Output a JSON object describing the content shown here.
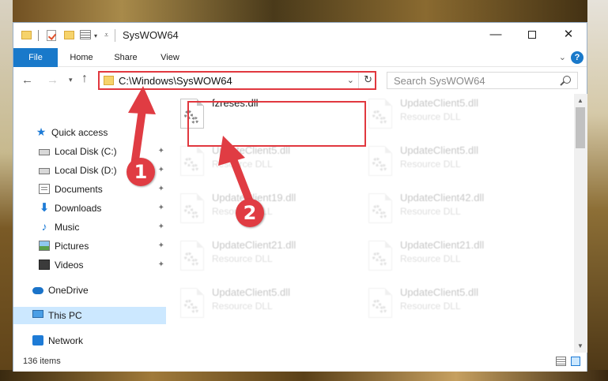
{
  "window": {
    "title": "SysWOW64",
    "minimize": "—",
    "close": "✕"
  },
  "ribbon": {
    "tabs": [
      "File",
      "Home",
      "Share",
      "View"
    ],
    "help": "?",
    "collapse": "⌄"
  },
  "nav": {
    "back": "←",
    "forward": "→",
    "recent": "▾",
    "up": "↑",
    "address": "C:\\Windows\\SysWOW64",
    "address_dropdown": "⌄",
    "refresh": "↻",
    "search_placeholder": "Search SysWOW64"
  },
  "sidebar": {
    "items": [
      {
        "label": "Quick access",
        "icon": "star-icon",
        "pinned": false
      },
      {
        "label": "Local Disk (C:)",
        "icon": "drive-icon",
        "pinned": true
      },
      {
        "label": "Local Disk (D:)",
        "icon": "drive-icon",
        "pinned": true
      },
      {
        "label": "Documents",
        "icon": "documents-icon",
        "pinned": true
      },
      {
        "label": "Downloads",
        "icon": "downloads-icon",
        "pinned": true
      },
      {
        "label": "Music",
        "icon": "music-icon",
        "pinned": true
      },
      {
        "label": "Pictures",
        "icon": "pictures-icon",
        "pinned": true
      },
      {
        "label": "Videos",
        "icon": "videos-icon",
        "pinned": true
      },
      {
        "label": "OneDrive",
        "icon": "onedrive-icon",
        "pinned": false
      },
      {
        "label": "This PC",
        "icon": "pc-icon",
        "pinned": false,
        "selected": true
      },
      {
        "label": "Network",
        "icon": "network-icon",
        "pinned": false
      }
    ],
    "pin_glyph": "📌"
  },
  "files": [
    {
      "name": "fzreses.dll",
      "type": "",
      "highlighted": true
    },
    {
      "name": "UpdateClient5.dll",
      "type": "Resource DLL"
    },
    {
      "name": "UpdateClient5.dll",
      "type": "Resource DLL"
    },
    {
      "name": "UpdateClient5.dll",
      "type": "Resource DLL"
    },
    {
      "name": "UpdateClient19.dll",
      "type": "Resource DLL"
    },
    {
      "name": "UpdateClient42.dll",
      "type": "Resource DLL"
    },
    {
      "name": "UpdateClient21.dll",
      "type": "Resource DLL"
    },
    {
      "name": "UpdateClient21.dll",
      "type": "Resource DLL"
    },
    {
      "name": "UpdateClient5.dll",
      "type": "Resource DLL"
    },
    {
      "name": "UpdateClient5.dll",
      "type": "Resource DLL"
    }
  ],
  "status": {
    "item_count": "136 items"
  },
  "callouts": {
    "step1": "1",
    "step2": "2"
  },
  "colors": {
    "accent": "#1979ca",
    "highlight": "#e1383f",
    "selected": "#cce8ff"
  }
}
